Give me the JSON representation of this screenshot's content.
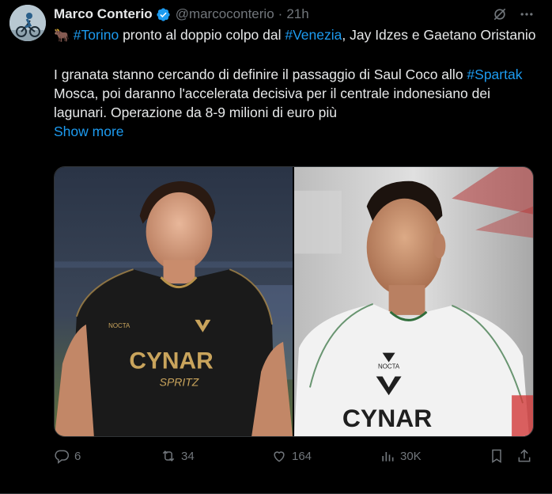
{
  "tweet": {
    "author": {
      "display_name": "Marco Conterio",
      "handle": "@marcoconterio",
      "verified_icon": "verified-badge-icon",
      "avatar": "avatar-cyclist"
    },
    "separator": "·",
    "time": "21h",
    "text": {
      "emoji": "🐂",
      "hashtag_torino": "#Torino",
      "line1_a": " pronto al doppio colpo dal ",
      "hashtag_venezia": "#Venezia",
      "line1_b": ", Jay Idzes e Gaetano Oristanio",
      "para2_a": "I granata stanno cercando di definire il passaggio di Saul Coco allo ",
      "hashtag_spartak": "#Spartak",
      "para2_b": " Mosca, poi daranno l'accelerata decisiva per il centrale indonesiano dei lagunari. Operazione da 8-9 milioni di euro più",
      "show_more": "Show more"
    },
    "media": {
      "left_photo": {
        "jersey_text": "CYNAR",
        "jersey_subtext": "SPRITZ",
        "brand": "NOCTA",
        "jersey_color": "#1a1a1a"
      },
      "right_photo": {
        "jersey_text": "CYNAR",
        "brand": "NOCTA",
        "jersey_color": "#f2f2f2"
      }
    },
    "stats": {
      "replies": "6",
      "reposts": "34",
      "likes": "164",
      "views": "30K"
    },
    "icons": {
      "grok": "grok-icon",
      "more": "more-icon",
      "reply": "reply-icon",
      "repost": "repost-icon",
      "like": "like-icon",
      "views": "views-icon",
      "bookmark": "bookmark-icon",
      "share": "share-icon"
    },
    "colors": {
      "background": "#000000",
      "text": "#e7e9ea",
      "muted": "#71767b",
      "accent": "#1d9bf0"
    }
  }
}
